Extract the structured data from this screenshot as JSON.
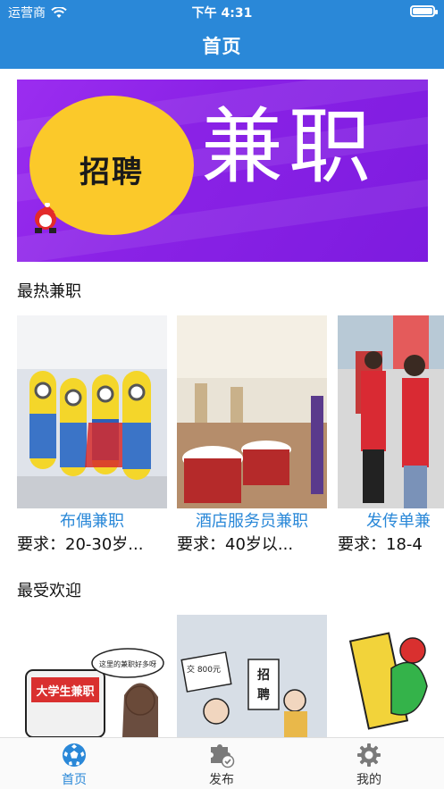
{
  "status_bar": {
    "carrier": "运营商",
    "time": "下午 4:31",
    "battery_level": 1.0
  },
  "header": {
    "title": "首页"
  },
  "banner": {
    "badge_text": "招聘",
    "headline": "兼职"
  },
  "sections": {
    "hot": {
      "title": "最热兼职",
      "items": [
        {
          "name": "布偶兼职",
          "requirement": "要求：20-30岁..."
        },
        {
          "name": "酒店服务员兼职",
          "requirement": "要求：40岁以..."
        },
        {
          "name": "发传单兼",
          "requirement": "要求：18-4"
        }
      ]
    },
    "popular": {
      "title": "最受欢迎"
    }
  },
  "tabbar": {
    "tabs": [
      {
        "label": "首页",
        "icon": "football-icon",
        "active": true
      },
      {
        "label": "发布",
        "icon": "puzzle-check-icon",
        "active": false
      },
      {
        "label": "我的",
        "icon": "gear-icon",
        "active": false
      }
    ]
  },
  "colors": {
    "primary": "#2a88d8",
    "banner_purple": "#8a22e6",
    "badge_yellow": "#fbc92a"
  }
}
